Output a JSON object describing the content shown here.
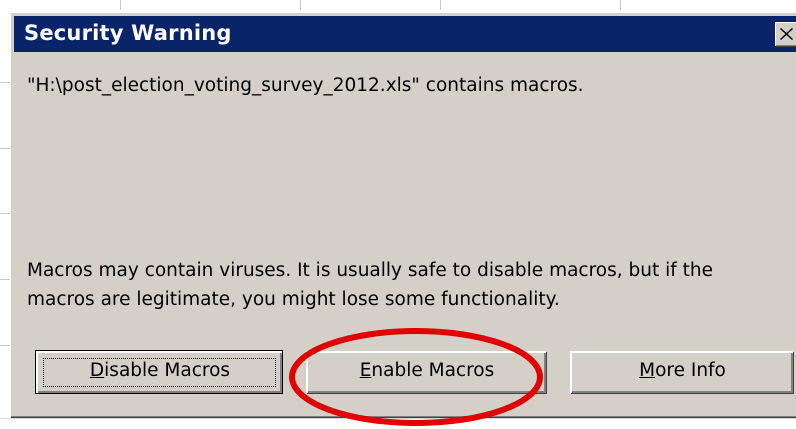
{
  "dialog": {
    "title": "Security Warning",
    "close_icon": "close-icon",
    "file_message": "\"H:\\post_election_voting_survey_2012.xls\" contains macros.",
    "warning_message": "Macros may contain viruses. It is usually safe to disable macros, but if the macros are legitimate, you might lose some functionality."
  },
  "buttons": {
    "disable": {
      "mnemonic": "D",
      "rest": "isable Macros"
    },
    "enable": {
      "mnemonic": "E",
      "rest": "nable Macros"
    },
    "info": {
      "mnemonic": "M",
      "rest": "ore Info"
    }
  },
  "colors": {
    "titlebar": "#0a246a",
    "dialog_face": "#d4d0c8",
    "annotation_ellipse": "#e00000"
  },
  "annotation": {
    "shape": "ellipse",
    "highlights": "enable-macros-button"
  }
}
